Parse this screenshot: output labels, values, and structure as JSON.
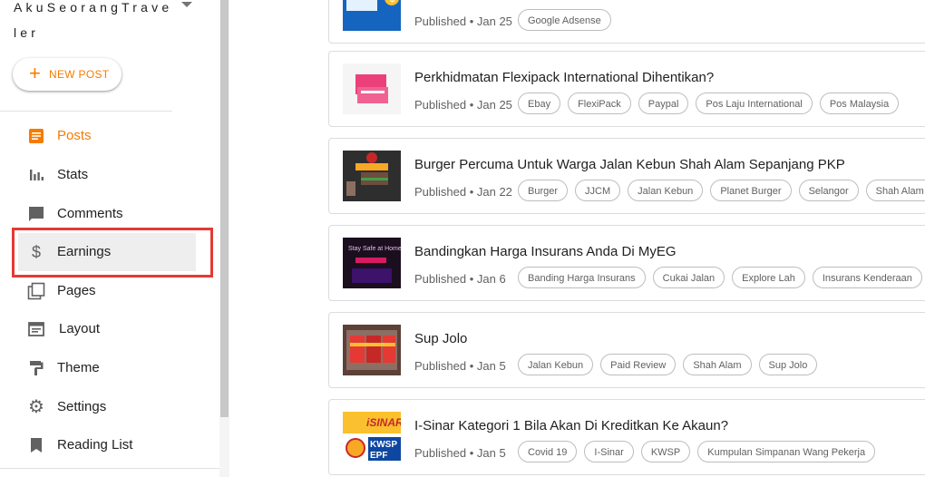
{
  "sidebar": {
    "blog_title": "AkuSeorangTraveler",
    "new_post_label": "NEW POST",
    "items": [
      {
        "label": "Posts",
        "icon": "posts-icon",
        "active": true
      },
      {
        "label": "Stats",
        "icon": "stats-icon"
      },
      {
        "label": "Comments",
        "icon": "comments-icon"
      },
      {
        "label": "Earnings",
        "icon": "dollar-icon",
        "highlighted": true
      },
      {
        "label": "Pages",
        "icon": "pages-icon"
      },
      {
        "label": "Layout",
        "icon": "layout-icon"
      },
      {
        "label": "Theme",
        "icon": "theme-icon"
      },
      {
        "label": "Settings",
        "icon": "gear-icon"
      },
      {
        "label": "Reading List",
        "icon": "bookmark-icon"
      }
    ]
  },
  "posts": [
    {
      "title": "",
      "meta": "Published • Jan 25",
      "tags": [
        "Google Adsense"
      ]
    },
    {
      "title": "Perkhidmatan Flexipack International Dihentikan?",
      "meta": "Published • Jan 25",
      "tags": [
        "Ebay",
        "FlexiPack",
        "Paypal",
        "Pos Laju International",
        "Pos Malaysia"
      ]
    },
    {
      "title": "Burger Percuma Untuk Warga Jalan Kebun Shah Alam Sepanjang PKP",
      "meta": "Published • Jan 22",
      "tags": [
        "Burger",
        "JJCM",
        "Jalan Kebun",
        "Planet Burger",
        "Selangor",
        "Shah Alam"
      ]
    },
    {
      "title": "Bandingkan Harga Insurans Anda Di MyEG",
      "meta": "Published • Jan 6",
      "tags": [
        "Banding Harga Insurans",
        "Cukai Jalan",
        "Explore Lah",
        "Insurans Kenderaan"
      ]
    },
    {
      "title": "Sup Jolo",
      "meta": "Published • Jan 5",
      "tags": [
        "Jalan Kebun",
        "Paid Review",
        "Shah Alam",
        "Sup Jolo"
      ]
    },
    {
      "title": "I-Sinar Kategori 1 Bila Akan Di Kreditkan Ke Akaun?",
      "meta": "Published • Jan 5",
      "tags": [
        "Covid 19",
        "I-Sinar",
        "KWSP",
        "Kumpulan Simpanan Wang Pekerja"
      ]
    }
  ],
  "colors": {
    "accent": "#f57c00",
    "highlight_box": "#e53935"
  }
}
